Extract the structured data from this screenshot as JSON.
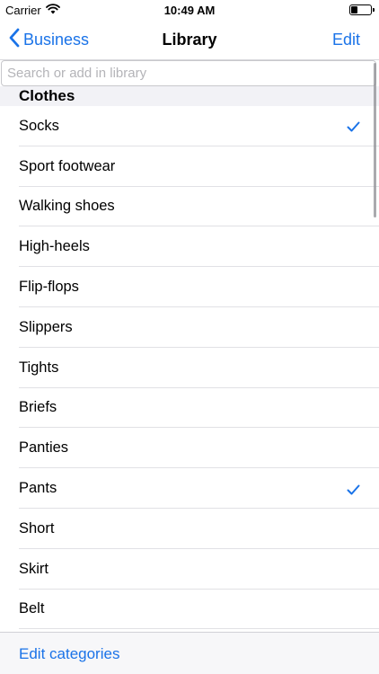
{
  "status_bar": {
    "carrier": "Carrier",
    "time": "10:49 AM",
    "battery_level": 0.35
  },
  "nav": {
    "back_label": "Business",
    "title": "Library",
    "edit_label": "Edit"
  },
  "search": {
    "placeholder": "Search or add in library",
    "value": ""
  },
  "section": {
    "title": "Clothes"
  },
  "items": [
    {
      "label": "Socks",
      "checked": true
    },
    {
      "label": "Sport footwear",
      "checked": false
    },
    {
      "label": "Walking shoes",
      "checked": false
    },
    {
      "label": "High-heels",
      "checked": false
    },
    {
      "label": "Flip-flops",
      "checked": false
    },
    {
      "label": "Slippers",
      "checked": false
    },
    {
      "label": "Tights",
      "checked": false
    },
    {
      "label": "Briefs",
      "checked": false
    },
    {
      "label": "Panties",
      "checked": false
    },
    {
      "label": "Pants",
      "checked": true
    },
    {
      "label": "Short",
      "checked": false
    },
    {
      "label": "Skirt",
      "checked": false
    },
    {
      "label": "Belt",
      "checked": false
    }
  ],
  "toolbar": {
    "edit_categories_label": "Edit categories"
  },
  "colors": {
    "accent": "#1a73e8",
    "separator": "#e1e1e5",
    "section_bg": "#f2f2f6"
  },
  "icons": {
    "back": "chevron-left-icon",
    "check": "checkmark-icon",
    "wifi": "wifi-icon",
    "battery": "battery-icon"
  }
}
